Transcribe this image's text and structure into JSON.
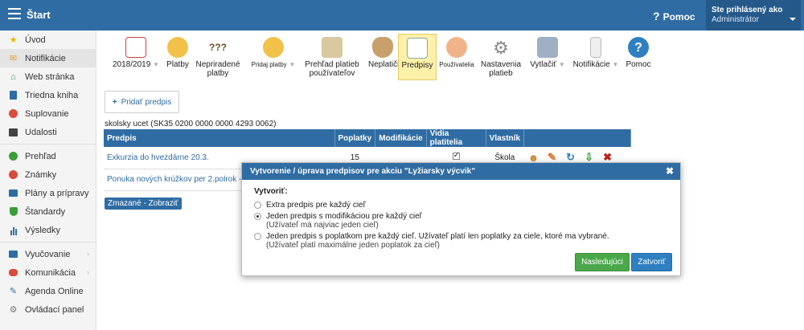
{
  "topbar": {
    "title": "Štart",
    "help_label": "Pomoc",
    "user_line1": "Ste prihlásený ako",
    "user_line2": "Administrátor"
  },
  "sidebar": {
    "items": [
      {
        "label": "Úvod",
        "icon": "star-icon",
        "color": "#f0b400"
      },
      {
        "label": "Notifikácie",
        "icon": "envelope-icon",
        "color": "#e59a2f"
      },
      {
        "label": "Web stránka",
        "icon": "home-icon",
        "color": "#2e9a5d"
      },
      {
        "label": "Triedna kniha",
        "icon": "book-icon",
        "color": "#2f6ca3"
      },
      {
        "label": "Suplovanie",
        "icon": "person-icon",
        "color": "#d94b3a"
      },
      {
        "label": "Udalosti",
        "icon": "calendar-icon",
        "color": "#444444"
      },
      {
        "label": "Prehľad",
        "icon": "check-circle-icon",
        "color": "#3a9d3a"
      },
      {
        "label": "Známky",
        "icon": "grade-icon",
        "color": "#d94b3a"
      },
      {
        "label": "Plány a prípravy",
        "icon": "briefcase-icon",
        "color": "#2f6ca3"
      },
      {
        "label": "Štandardy",
        "icon": "shield-check-icon",
        "color": "#3a9d3a"
      },
      {
        "label": "Výsledky",
        "icon": "bar-chart-icon",
        "color": "#2f6ca3"
      },
      {
        "label": "Vyučovanie",
        "icon": "briefcase-icon",
        "color": "#2f6ca3"
      },
      {
        "label": "Komunikácia",
        "icon": "chat-icon",
        "color": "#d94b3a"
      },
      {
        "label": "Agenda Online",
        "icon": "pencil-icon",
        "color": "#2f6ca3"
      },
      {
        "label": "Ovládací panel",
        "icon": "gear-icon",
        "color": "#777777"
      }
    ]
  },
  "toolbar": {
    "items": [
      {
        "label": "2018/2019",
        "icon": "calendar-icon"
      },
      {
        "label": "Platby",
        "icon": "globe-icon"
      },
      {
        "label": "Nepriradené platby",
        "icon": "question-coins-icon"
      },
      {
        "label": "Pridaj platby",
        "icon": "globe-add-icon"
      },
      {
        "label": "Prehľad platieb používateľov",
        "icon": "box-icon"
      },
      {
        "label": "Neplatiči",
        "icon": "money-bag-icon"
      },
      {
        "label": "Predpisy",
        "icon": "document-icon"
      },
      {
        "label": "Používatelia",
        "icon": "users-icon"
      },
      {
        "label": "Nastavenia platieb",
        "icon": "gear-icon"
      },
      {
        "label": "Vytlačiť",
        "icon": "printer-icon"
      },
      {
        "label": "Notifikácie",
        "icon": "phone-icon"
      },
      {
        "label": "Pomoc",
        "icon": "help-icon"
      }
    ]
  },
  "add_button": "Pridať predpis",
  "account_line": "skolsky ucet (SK35 0200 0000 0000 4293 0062)",
  "table": {
    "headers": [
      "Predpis",
      "Poplatky",
      "Modifikácie",
      "Vidia platitelia",
      "Vlastník"
    ],
    "rows": [
      {
        "name": "Exkurzia do hvezdárne 20.3.",
        "fees": "15",
        "mods": "",
        "owner": "Škola"
      },
      {
        "name": "Ponuka nových krúžkov per 2.polrok - P",
        "fees": "",
        "mods": "",
        "owner": ""
      }
    ]
  },
  "deleted_button": "Zmazané - Zobraziť",
  "modal": {
    "title": "Vytvorenie / úprava predpisov pre akciu \"Lyžiarsky výcvik\"",
    "field_label": "Vytvoriť:",
    "options": [
      {
        "line1": "Extra predpis pre každý cieľ",
        "line2": ""
      },
      {
        "line1": "Jeden predpis s modifikáciou pre každý cieľ",
        "line2": "(Užívateľ má najviac jeden cieľ)"
      },
      {
        "line1": "Jeden predpis s poplatkom pre každý cieľ. Užívateľ platí len poplatky za ciele, ktoré ma vybrané.",
        "line2": "(Užívateľ platí maximálne jeden poplatok za cieľ)"
      }
    ],
    "selected_option": 1,
    "next_button": "Nasledujúci",
    "close_button": "Zatvoriť"
  }
}
